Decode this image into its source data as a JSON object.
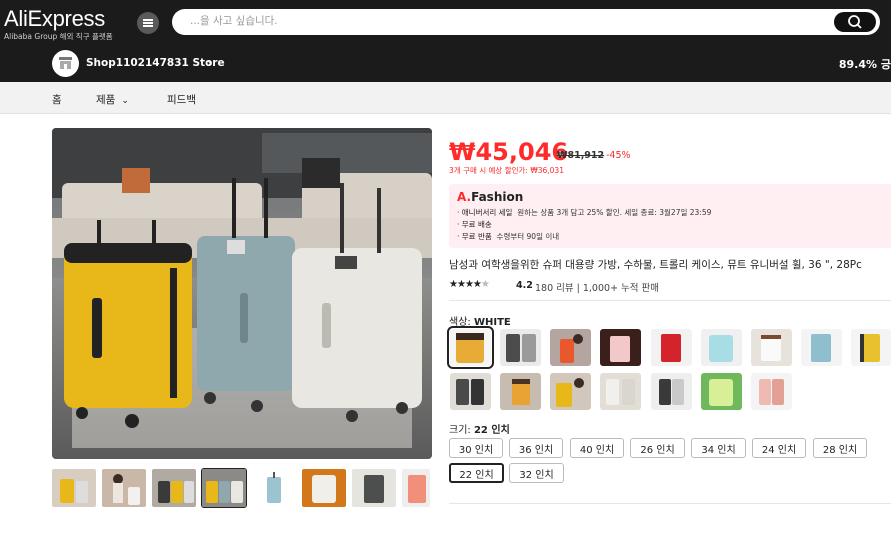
{
  "header": {
    "logo": "AliExpress",
    "logo_sub": "Alibaba Group 해외 직구 플랫폼",
    "menu_icon": "hamburger-menu-icon",
    "search_placeholder": "...을 사고 싶습니다.",
    "search_icon": "search-icon"
  },
  "store": {
    "name": "Shop1102147831 Store",
    "chevron": "›",
    "positive_rating": "89.4% 긍"
  },
  "nav": {
    "home": "홈",
    "products": "제품",
    "products_caret": "⌄",
    "feedback": "피드백"
  },
  "product": {
    "price": "₩45,046",
    "original_price": "₩81,912",
    "discount": "-45%",
    "bulk_offer": "3개 구매 시 예상 할인가: ₩36,031",
    "promo": {
      "brand_prefix": "A.",
      "brand_name": "Fashion",
      "lines": [
        {
          "key": "· 애니버서리 세일",
          "text": "원하는 상품 3개 담고 25% 할인. 세일 종료: 3월27일 23:59"
        },
        {
          "key": "· 무료 배송",
          "text": ""
        },
        {
          "key": "· 무료 반품",
          "text": "수령부터 90일 이내"
        }
      ]
    },
    "title": "남성과 여학생을위한 슈퍼 대용량 가방, 수하물, 트롤리 케이스, 뮤트 유니버설 휠, 36 \", 28Pc",
    "stars": 4,
    "rating": "4.2",
    "reviews": "180 리뷰  |  1,000+ 누적 판매",
    "color_label": "색상:",
    "color_value": "WHITE",
    "size_label": "크기:",
    "size_value": "22 인치",
    "sizes": [
      "30 인치",
      "36 인치",
      "40 인치",
      "26 인치",
      "34 인치",
      "24 인치",
      "28 인치",
      "22 인치",
      "32 인치"
    ],
    "selected_size": "22 인치"
  },
  "colors": {
    "accent": "#ff2a2a",
    "header_bg": "#1b1b1b",
    "promo_bg": "#ffeef2"
  }
}
